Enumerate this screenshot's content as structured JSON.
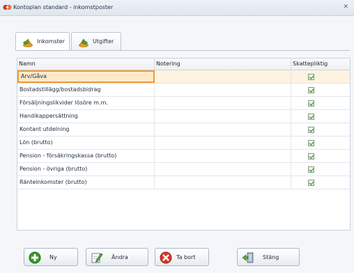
{
  "window": {
    "title": "Kontoplan standard - inkomstposter",
    "close_glyph": "✕"
  },
  "tabs": [
    {
      "label": "Inkomster",
      "icon": "money-bag-icon",
      "active": true
    },
    {
      "label": "Utgifter",
      "icon": "money-bag-icon",
      "active": false
    }
  ],
  "grid": {
    "columns": [
      "Namn",
      "Notering",
      "Skattepliktig"
    ],
    "rows": [
      {
        "name": "Arv/Gåva",
        "note": "",
        "taxable": true,
        "selected": true
      },
      {
        "name": "Bostadstillägg/bostadsbidrag",
        "note": "",
        "taxable": true
      },
      {
        "name": "Försäljningslikvider lösöre m.m.",
        "note": "",
        "taxable": true
      },
      {
        "name": "Handikappersättning",
        "note": "",
        "taxable": true
      },
      {
        "name": "Kontant utdelning",
        "note": "",
        "taxable": true
      },
      {
        "name": "Lön (brutto)",
        "note": "",
        "taxable": true
      },
      {
        "name": "Pension - försäkringskassa (brutto)",
        "note": "",
        "taxable": true
      },
      {
        "name": "Pension - övriga (brutto)",
        "note": "",
        "taxable": true
      },
      {
        "name": "Ränteinkomster (brutto)",
        "note": "",
        "taxable": true
      }
    ]
  },
  "buttons": {
    "new": {
      "label": "Ny",
      "icon": "plus-circle-icon"
    },
    "edit": {
      "label": "Ändra",
      "icon": "edit-pencil-icon"
    },
    "delete": {
      "label": "Ta bort",
      "icon": "delete-x-icon"
    },
    "close": {
      "label": "Stäng",
      "icon": "exit-door-icon"
    }
  },
  "colors": {
    "selection_border": "#f09a36",
    "selection_fill": "#fde9c8",
    "add_green": "#3a9a2c",
    "delete_red": "#d9362b"
  }
}
